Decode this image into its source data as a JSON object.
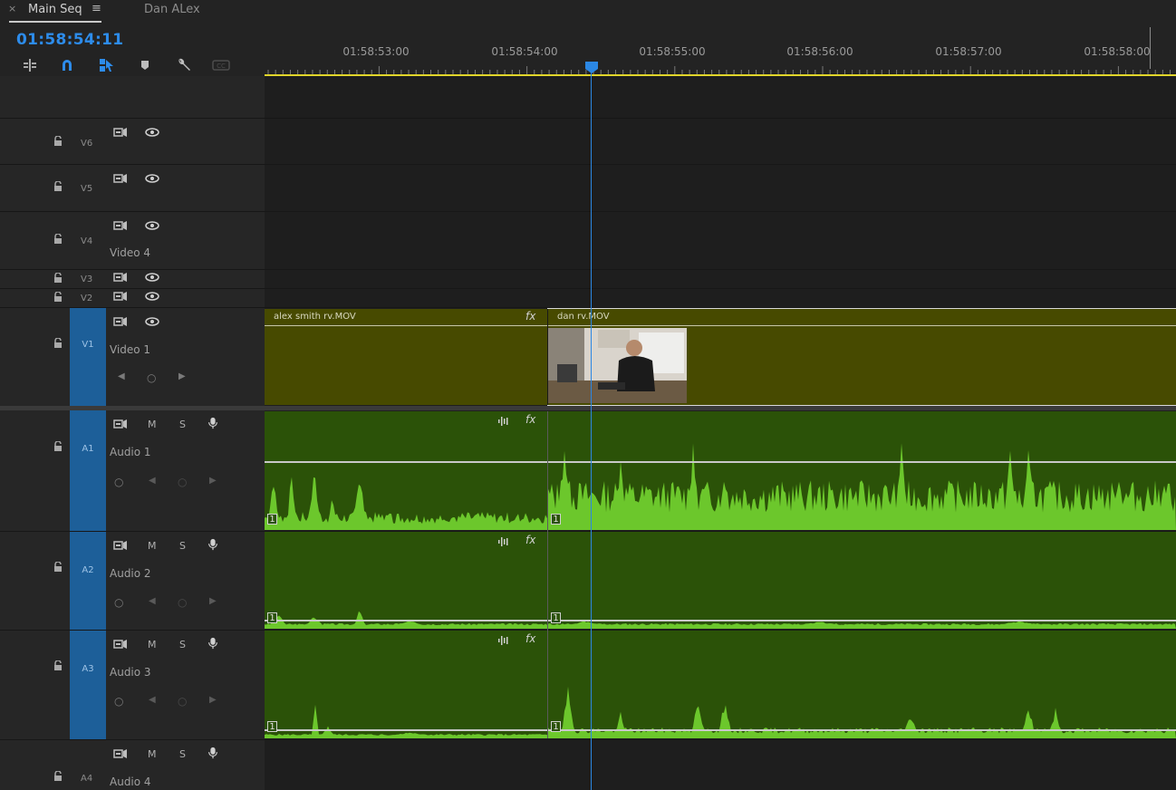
{
  "tabs": {
    "close": "×",
    "active": "Main Seq",
    "menu": "≡",
    "inactive": "Dan ALex"
  },
  "timecode": "01:58:54:11",
  "toolbar": [
    {
      "icon": "insert-overwrite-icon"
    },
    {
      "icon": "snap-magnet-icon"
    },
    {
      "icon": "linked-selection-icon"
    },
    {
      "icon": "add-marker-icon"
    },
    {
      "icon": "wrench-settings-icon"
    },
    {
      "icon": "captions-icon"
    }
  ],
  "ruler": {
    "labels": [
      "01:58:53:00",
      "01:58:54:00",
      "01:58:55:00",
      "01:58:56:00",
      "01:58:57:00",
      "01:58:58:00"
    ]
  },
  "tracks": {
    "v6": {
      "id": "V6",
      "name": ""
    },
    "v5": {
      "id": "V5",
      "name": ""
    },
    "v4": {
      "id": "V4",
      "name": "Video 4"
    },
    "v3": {
      "id": "V3",
      "name": ""
    },
    "v2": {
      "id": "V2",
      "name": ""
    },
    "v1": {
      "id": "V1",
      "name": "Video 1"
    },
    "a1": {
      "id": "A1",
      "name": "Audio 1",
      "m": "M",
      "s": "S"
    },
    "a2": {
      "id": "A2",
      "name": "Audio 2",
      "m": "M",
      "s": "S"
    },
    "a3": {
      "id": "A3",
      "name": "Audio 3",
      "m": "M",
      "s": "S"
    },
    "a4": {
      "id": "A4",
      "name": "Audio 4",
      "m": "M",
      "s": "S"
    }
  },
  "keyframe_nav": {
    "prev": "◀",
    "add": "○",
    "next": "▶",
    "level": "○"
  },
  "clips": {
    "video1": {
      "name": "alex smith rv.MOV",
      "fx": "fx"
    },
    "video2": {
      "name": "dan rv.MOV"
    },
    "audio_fx": "fx",
    "channel": "1"
  },
  "colors": {
    "accent": "#2d8ceb",
    "video_clip": "#474a00",
    "audio_clip": "#2b5208",
    "waveform": "#6cc72c",
    "target": "#1d5f99",
    "in_out_bar": "#e1d52a"
  }
}
